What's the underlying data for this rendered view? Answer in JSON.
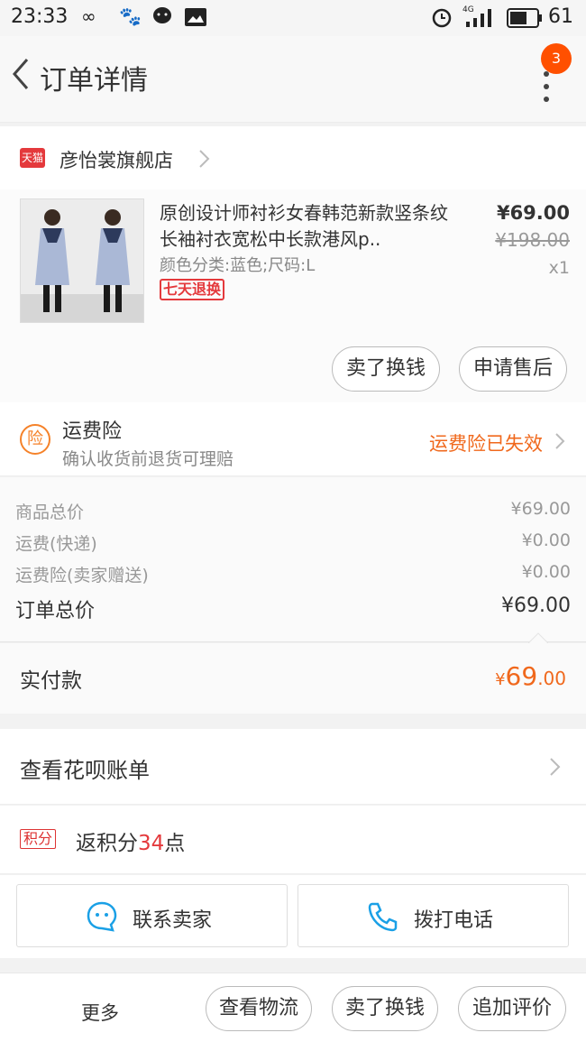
{
  "status_bar": {
    "time": "23:33",
    "battery": "61",
    "network": "4G"
  },
  "header": {
    "title": "订单详情",
    "badge": "3"
  },
  "shop": {
    "logo_text": "天猫",
    "name": "彦怡裳旗舰店"
  },
  "product": {
    "title": "原创设计师衬衫女春韩范新款竖条纹长袖衬衣宽松中长款港风p..",
    "spec": "颜色分类:蓝色;尺码:L",
    "return_tag": "七天退换",
    "price": "¥69.00",
    "original_price": "¥198.00",
    "quantity": "x1",
    "actions": [
      "卖了换钱",
      "申请售后"
    ]
  },
  "insurance": {
    "icon_text": "险",
    "title": "运费险",
    "subtitle": "确认收货前退货可理赔",
    "status": "运费险已失效"
  },
  "summary": {
    "items": [
      {
        "label": "商品总价",
        "value": "¥69.00"
      },
      {
        "label": "运费(快递)",
        "value": "¥0.00"
      },
      {
        "label": "运费险(卖家赠送)",
        "value": "¥0.00"
      }
    ],
    "total_label": "订单总价",
    "total_value": "¥69.00"
  },
  "paid": {
    "label": "实付款",
    "currency": "¥",
    "integer": "69",
    "decimal": ".00"
  },
  "huabei": {
    "label": "查看花呗账单"
  },
  "points": {
    "tag": "积分",
    "prefix": "返积分",
    "number": "34",
    "suffix": "点"
  },
  "contact": {
    "seller": "联系卖家",
    "phone": "拨打电话"
  },
  "bottom": {
    "more": "更多",
    "buttons": [
      "查看物流",
      "卖了换钱",
      "追加评价"
    ]
  },
  "colors": {
    "accent": "#f0681c",
    "badge": "#ff5000",
    "tmall": "#e4393c",
    "icon_blue": "#1aa0e6"
  }
}
